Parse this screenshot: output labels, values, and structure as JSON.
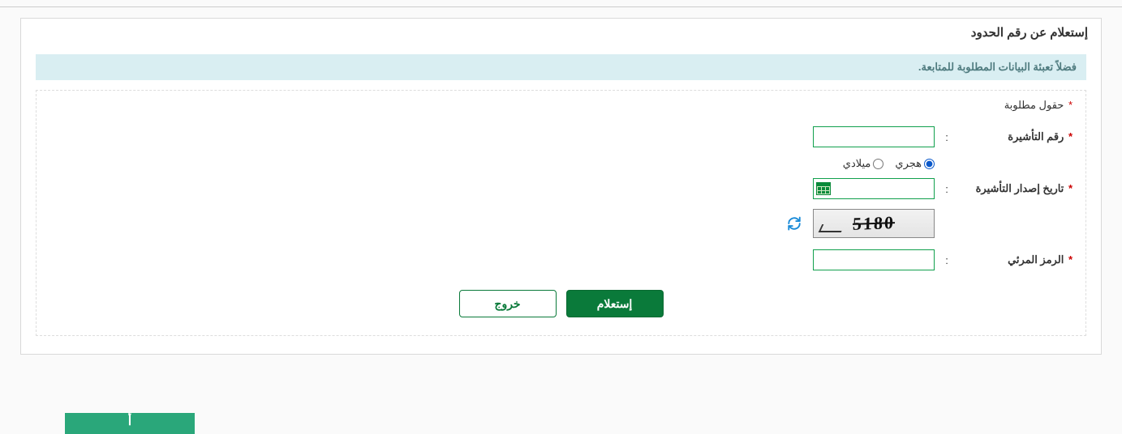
{
  "panel": {
    "title": "إستعلام عن رقم الحدود",
    "banner": "فضلاً تعبئة البيانات المطلوبة للمتابعة.",
    "required_note": "حقول مطلوبة"
  },
  "labels": {
    "visa_number": "رقم التأشيرة",
    "visa_issue_date": "تاريخ إصدار التأشيرة",
    "captcha": "الرمز المرئي",
    "colon": ":"
  },
  "calendar": {
    "hijri": "هجري",
    "miladi": "ميلادي"
  },
  "captcha": {
    "value": "5180"
  },
  "buttons": {
    "inquire": "إستعلام",
    "exit": "خروج"
  },
  "fields": {
    "visa_number_value": "",
    "visa_issue_date_value": "",
    "captcha_input_value": ""
  }
}
